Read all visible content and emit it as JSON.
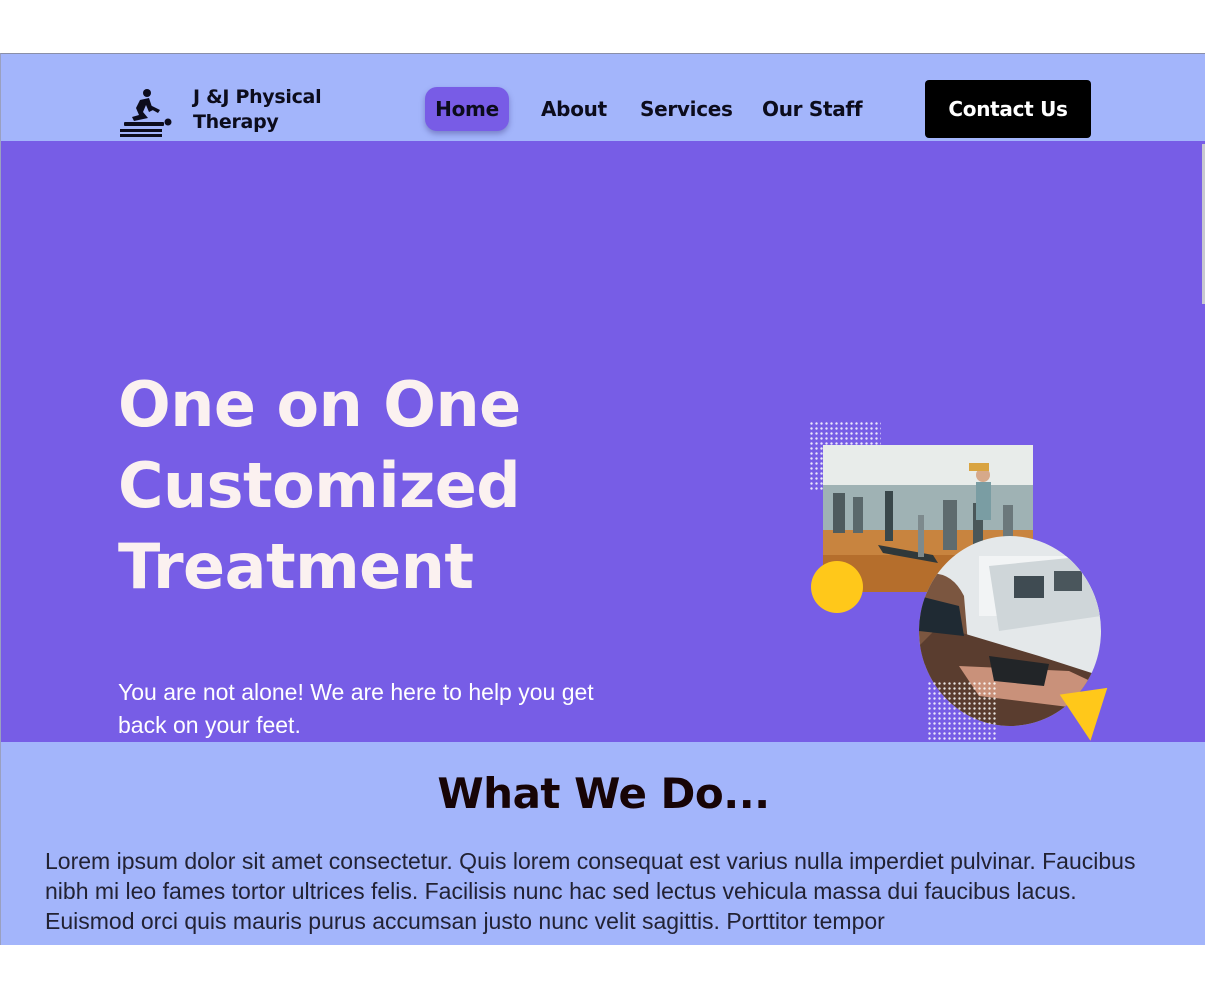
{
  "header": {
    "brand": "J &J Physical Therapy",
    "logo_icon": "massage-therapy-icon",
    "nav": [
      {
        "label": "Home",
        "active": true
      },
      {
        "label": "About"
      },
      {
        "label": "Services"
      },
      {
        "label": "Our Staff"
      }
    ],
    "cta_label": "Contact Us"
  },
  "hero": {
    "title_lines": [
      "One on One",
      "Customized",
      "Treatment"
    ],
    "subtitle": "You are not alone! We are here to help you get back on your feet.",
    "images": [
      "gym-equipment-photo",
      "therapy-hand-photo"
    ]
  },
  "what_we_do": {
    "title": "What We Do...",
    "body": "Lorem ipsum dolor sit amet consectetur. Quis lorem consequat est varius nulla imperdiet pulvinar. Faucibus nibh mi leo fames tortor ultrices felis. Facilisis nunc hac sed lectus vehicula massa dui faucibus lacus. Euismod orci quis mauris purus accumsan justo nunc velit sagittis. Porttitor tempor"
  },
  "colors": {
    "header_bg": "#a3b5fb",
    "hero_bg": "#775de6",
    "accent_yellow": "#ffc81a",
    "button_black": "#000000",
    "hero_text": "#fbf1f0"
  }
}
